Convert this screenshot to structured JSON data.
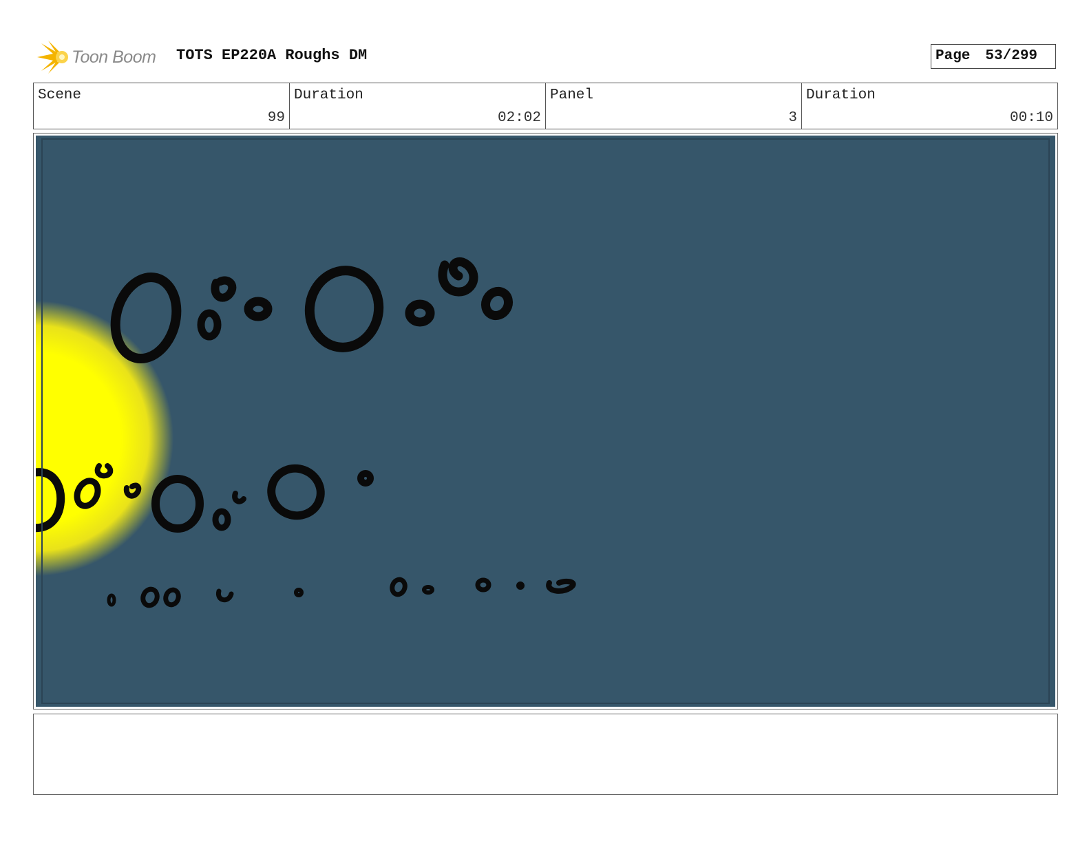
{
  "header": {
    "logo_text": "Toon Boom",
    "title": "TOTS EP220A Roughs DM",
    "page_label": "Page",
    "page_number": "53/299"
  },
  "info": {
    "scene_label": "Scene",
    "scene_value": "99",
    "scene_duration_label": "Duration",
    "scene_duration_value": "02:02",
    "panel_label": "Panel",
    "panel_value": "3",
    "panel_duration_label": "Duration",
    "panel_duration_value": "00:10"
  },
  "colors": {
    "panel_background": "#36566a",
    "glow_center": "#ffff00",
    "bubble_ink": "#0a0a0a",
    "logo_flame": "#f4b400"
  },
  "notes": ""
}
